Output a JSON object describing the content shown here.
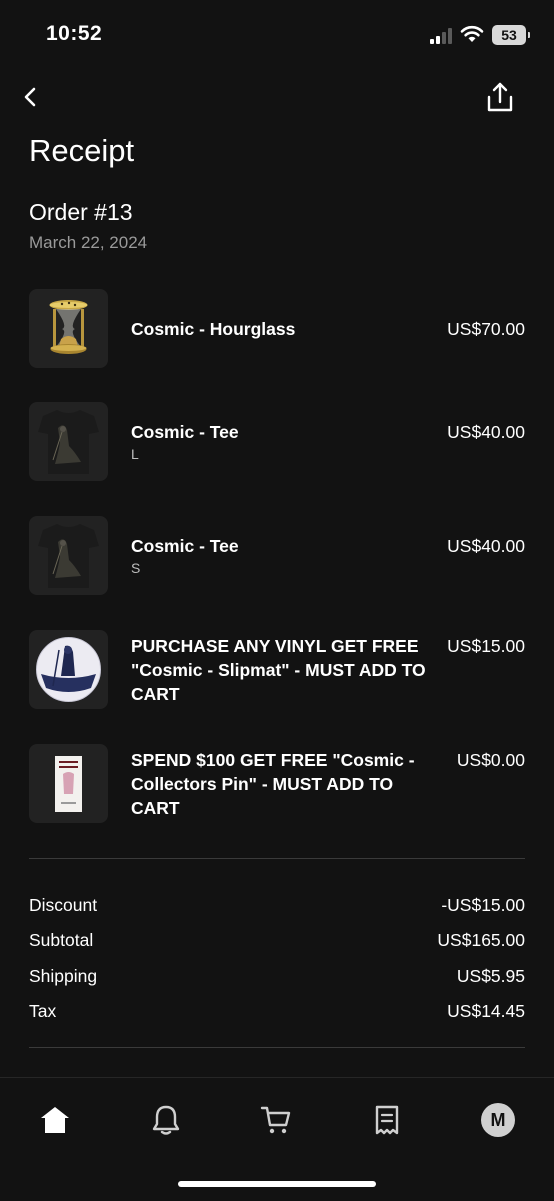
{
  "status": {
    "time": "10:52",
    "battery": "53"
  },
  "header": {
    "title": "Receipt"
  },
  "order": {
    "number": "Order #13",
    "date": "March 22, 2024"
  },
  "items": [
    {
      "name": "Cosmic - Hourglass",
      "variant": "",
      "price": "US$70.00"
    },
    {
      "name": "Cosmic - Tee",
      "variant": "L",
      "price": "US$40.00"
    },
    {
      "name": "Cosmic - Tee",
      "variant": "S",
      "price": "US$40.00"
    },
    {
      "name": "PURCHASE ANY VINYL GET FREE \"Cosmic - Slipmat\" - MUST ADD TO CART",
      "variant": "",
      "price": "US$15.00"
    },
    {
      "name": "SPEND $100 GET FREE \"Cosmic - Collectors Pin\" - MUST ADD TO CART",
      "variant": "",
      "price": "US$0.00"
    }
  ],
  "summary": {
    "discount": {
      "label": "Discount",
      "value": "-US$15.00"
    },
    "subtotal": {
      "label": "Subtotal",
      "value": "US$165.00"
    },
    "shipping": {
      "label": "Shipping",
      "value": "US$5.95"
    },
    "tax": {
      "label": "Tax",
      "value": "US$14.45"
    }
  },
  "tab_bar": {
    "avatar_initial": "M"
  }
}
